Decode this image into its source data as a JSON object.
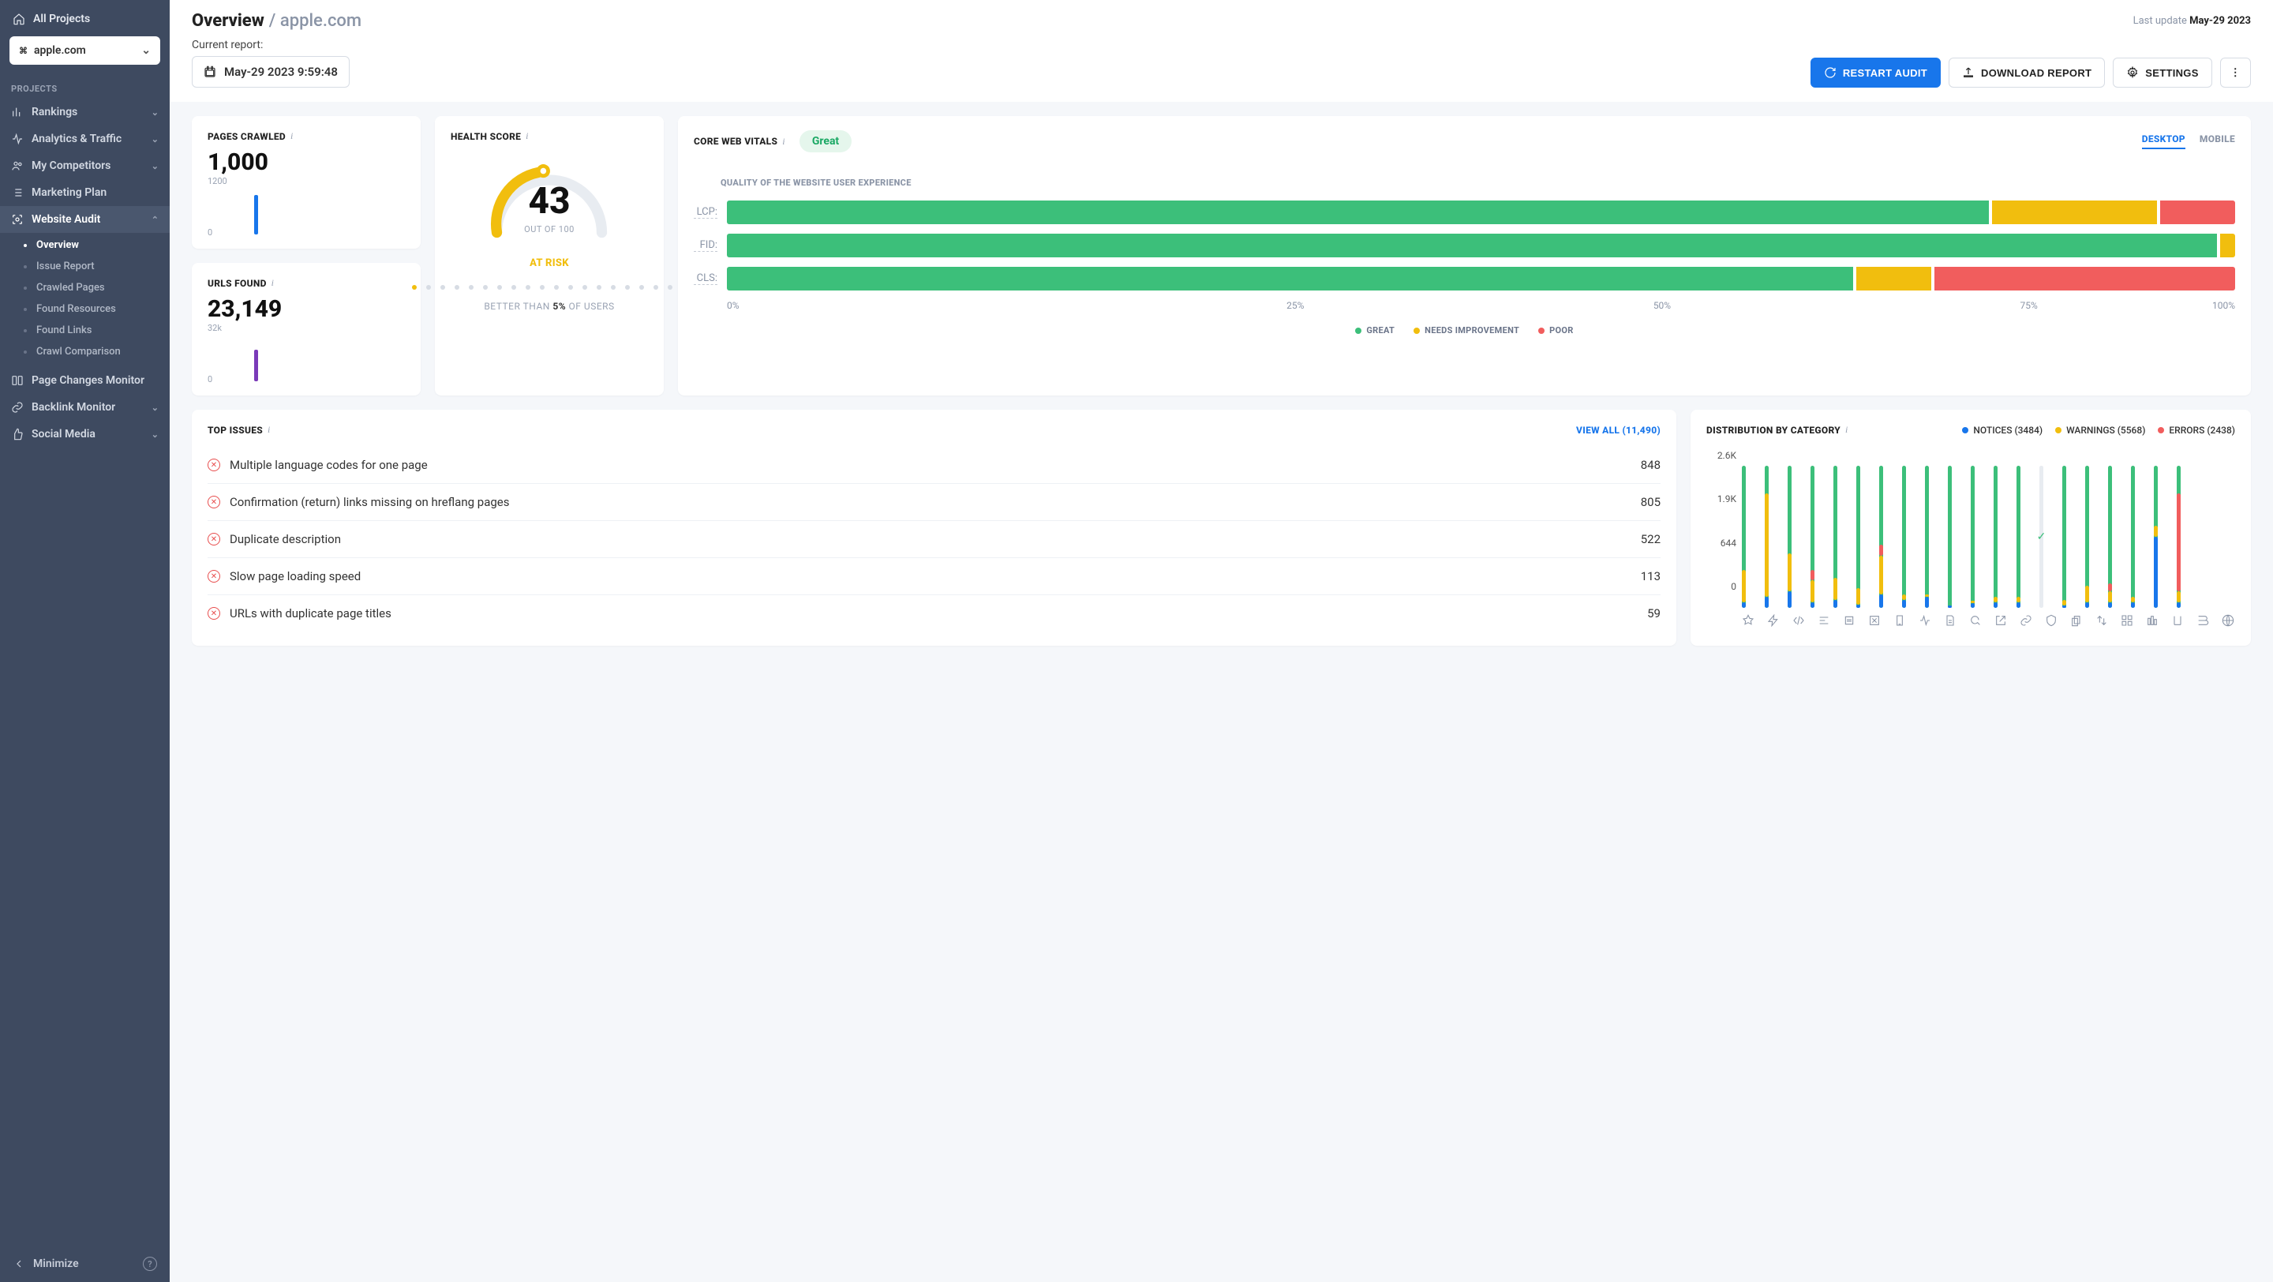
{
  "sidebar": {
    "all_projects": "All Projects",
    "project": "apple.com",
    "heading": "PROJECTS",
    "items": [
      {
        "label": "Rankings",
        "expandable": true
      },
      {
        "label": "Analytics & Traffic",
        "expandable": true
      },
      {
        "label": "My Competitors",
        "expandable": true
      },
      {
        "label": "Marketing Plan",
        "expandable": false
      },
      {
        "label": "Website Audit",
        "expandable": true,
        "active": true
      },
      {
        "label": "Page Changes Monitor",
        "expandable": false
      },
      {
        "label": "Backlink Monitor",
        "expandable": true
      },
      {
        "label": "Social Media",
        "expandable": true
      }
    ],
    "sub_items": [
      "Overview",
      "Issue Report",
      "Crawled Pages",
      "Found Resources",
      "Found Links",
      "Crawl Comparison"
    ],
    "minimize": "Minimize"
  },
  "header": {
    "title": "Overview",
    "subtitle": "apple.com",
    "last_update_label": "Last update ",
    "last_update_value": "May-29 2023",
    "current_report_label": "Current report:",
    "report_date": "May-29 2023 9:59:48",
    "btn_restart": "RESTART AUDIT",
    "btn_download": "DOWNLOAD REPORT",
    "btn_settings": "SETTINGS"
  },
  "pages_crawled": {
    "title": "PAGES CRAWLED",
    "value": "1,000",
    "y_top": "1200",
    "y_bot": "0"
  },
  "urls_found": {
    "title": "URLS FOUND",
    "value": "23,149",
    "y_top": "32k",
    "y_bot": "0"
  },
  "health": {
    "title": "HEALTH SCORE",
    "score": "43",
    "out_of": "OUT OF 100",
    "status": "AT RISK",
    "better_prefix": "BETTER THAN ",
    "better_val": "5%",
    "better_suffix": " OF USERS"
  },
  "cwv": {
    "title": "CORE WEB VITALS",
    "badge": "Great",
    "tab_desktop": "DESKTOP",
    "tab_mobile": "MOBILE",
    "subtitle": "QUALITY OF THE WEBSITE USER EXPERIENCE",
    "rows": [
      {
        "label": "LCP:",
        "g": 84,
        "y": 11,
        "r": 5
      },
      {
        "label": "FID:",
        "g": 99,
        "y": 1,
        "r": 0
      },
      {
        "label": "CLS:",
        "g": 75,
        "y": 5,
        "r": 20
      }
    ],
    "axis": [
      "0%",
      "25%",
      "50%",
      "75%",
      "100%"
    ],
    "legend": {
      "g": "GREAT",
      "y": "NEEDS IMPROVEMENT",
      "r": "POOR"
    }
  },
  "issues": {
    "title": "TOP ISSUES",
    "view_all": "VIEW ALL (11,490)",
    "rows": [
      {
        "name": "Multiple language codes for one page",
        "count": "848"
      },
      {
        "name": "Confirmation (return) links missing on hreflang pages",
        "count": "805"
      },
      {
        "name": "Duplicate description",
        "count": "522"
      },
      {
        "name": "Slow page loading speed",
        "count": "113"
      },
      {
        "name": "URLs with duplicate page titles",
        "count": "59"
      }
    ]
  },
  "dist": {
    "title": "DISTRIBUTION BY CATEGORY",
    "legend_notices": "NOTICES (3484)",
    "legend_warnings": "WARNINGS (5568)",
    "legend_errors": "ERRORS (2438)",
    "y_labels": [
      "2.6K",
      "1.9K",
      "644",
      "0"
    ]
  },
  "chart_data": [
    {
      "type": "bar",
      "title": "PAGES CRAWLED",
      "categories": [
        "1",
        "2",
        "3",
        "4",
        "5",
        "6",
        "7",
        "8",
        "9",
        "10"
      ],
      "values": [
        0,
        1000,
        0,
        0,
        0,
        0,
        0,
        0,
        0,
        0
      ],
      "ylim": [
        0,
        1200
      ]
    },
    {
      "type": "bar",
      "title": "URLS FOUND",
      "categories": [
        "1",
        "2",
        "3",
        "4",
        "5",
        "6",
        "7",
        "8",
        "9",
        "10"
      ],
      "values": [
        0,
        23149,
        0,
        0,
        0,
        0,
        0,
        0,
        0,
        0
      ],
      "ylim": [
        0,
        32000
      ]
    },
    {
      "type": "bar",
      "title": "QUALITY OF THE WEBSITE USER EXPERIENCE",
      "categories": [
        "LCP",
        "FID",
        "CLS"
      ],
      "series": [
        {
          "name": "GREAT",
          "values": [
            84,
            99,
            75
          ]
        },
        {
          "name": "NEEDS IMPROVEMENT",
          "values": [
            11,
            1,
            5
          ]
        },
        {
          "name": "POOR",
          "values": [
            5,
            0,
            20
          ]
        }
      ],
      "xlabel": "",
      "ylabel": "",
      "ylim": [
        0,
        100
      ]
    },
    {
      "type": "bar",
      "title": "DISTRIBUTION BY CATEGORY",
      "categories": [
        "c1",
        "c2",
        "c3",
        "c4",
        "c5",
        "c6",
        "c7",
        "c8",
        "c9",
        "c10",
        "c11",
        "c12",
        "c13",
        "c14",
        "c15",
        "c16",
        "c17",
        "c18",
        "c19",
        "c20"
      ],
      "series": [
        {
          "name": "NOTICES",
          "values": [
            100,
            200,
            300,
            100,
            150,
            60,
            250,
            150,
            200,
            50,
            80,
            100,
            100,
            0,
            50,
            100,
            100,
            100,
            1300,
            100
          ]
        },
        {
          "name": "WARNINGS",
          "values": [
            600,
            1900,
            700,
            400,
            400,
            300,
            700,
            100,
            50,
            0,
            50,
            100,
            100,
            0,
            100,
            300,
            200,
            100,
            200,
            200
          ]
        },
        {
          "name": "ERRORS",
          "values": [
            0,
            0,
            0,
            200,
            0,
            0,
            200,
            0,
            0,
            0,
            0,
            0,
            0,
            0,
            0,
            0,
            150,
            0,
            0,
            1800
          ]
        }
      ],
      "ylim": [
        0,
        2600
      ]
    }
  ]
}
